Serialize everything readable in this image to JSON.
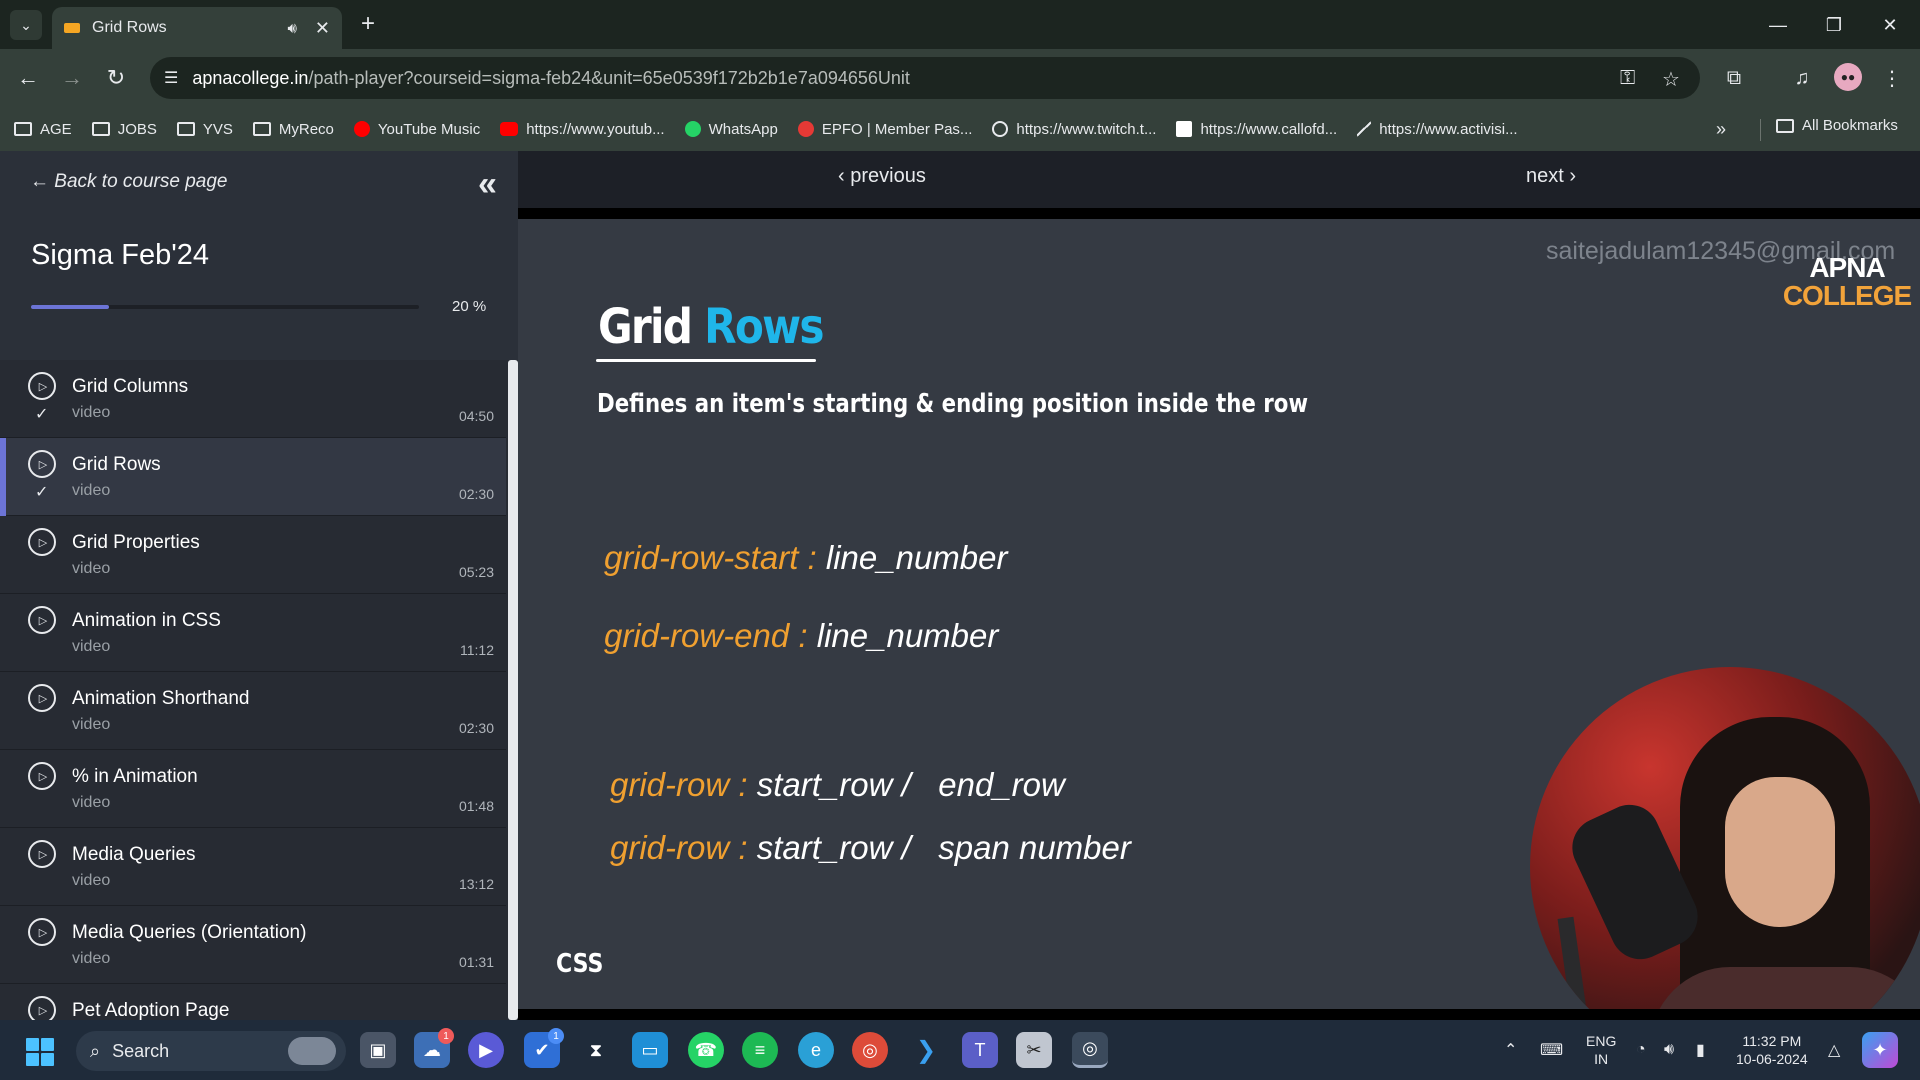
{
  "browser": {
    "tab": {
      "title": "Grid Rows"
    },
    "address": {
      "host": "apnacollege.in",
      "path": "/path-player?courseid=sigma-feb24&unit=65e0539f172b2b1e7a094656Unit"
    },
    "bookmarks": [
      {
        "label": "AGE",
        "icon": "folder-icon"
      },
      {
        "label": "JOBS",
        "icon": "folder-icon"
      },
      {
        "label": "YVS",
        "icon": "folder-icon"
      },
      {
        "label": "MyReco",
        "icon": "folder-icon"
      },
      {
        "label": "YouTube Music",
        "icon": "youtube-music-icon"
      },
      {
        "label": "https://www.youtub...",
        "icon": "youtube-icon"
      },
      {
        "label": "WhatsApp",
        "icon": "whatsapp-icon"
      },
      {
        "label": "EPFO | Member Pas...",
        "icon": "epfo-icon"
      },
      {
        "label": "https://www.twitch.t...",
        "icon": "globe-icon"
      },
      {
        "label": "https://www.callofd...",
        "icon": "callofduty-icon"
      },
      {
        "label": "https://www.activisi...",
        "icon": "activision-icon"
      }
    ],
    "all_bookmarks": "All Bookmarks"
  },
  "sidebar": {
    "back_label": "Back to course page",
    "course_title": "Sigma Feb'24",
    "progress": {
      "percent": 20,
      "label": "20 %"
    },
    "lessons": [
      {
        "title": "Grid Columns",
        "type": "video",
        "duration": "04:50",
        "completed": true,
        "active": false
      },
      {
        "title": "Grid Rows",
        "type": "video",
        "duration": "02:30",
        "completed": true,
        "active": true
      },
      {
        "title": "Grid Properties",
        "type": "video",
        "duration": "05:23",
        "completed": false,
        "active": false
      },
      {
        "title": "Animation in CSS",
        "type": "video",
        "duration": "11:12",
        "completed": false,
        "active": false
      },
      {
        "title": "Animation Shorthand",
        "type": "video",
        "duration": "02:30",
        "completed": false,
        "active": false
      },
      {
        "title": "% in Animation",
        "type": "video",
        "duration": "01:48",
        "completed": false,
        "active": false
      },
      {
        "title": "Media Queries",
        "type": "video",
        "duration": "13:12",
        "completed": false,
        "active": false
      },
      {
        "title": "Media Queries (Orientation)",
        "type": "video",
        "duration": "01:31",
        "completed": false,
        "active": false
      },
      {
        "title": "Pet Adoption Page",
        "type": "video",
        "duration": "",
        "completed": false,
        "active": false
      }
    ]
  },
  "content": {
    "previous_label": "previous",
    "next_label": "next"
  },
  "slide": {
    "watermark": "saitejadulam12345@gmail.com",
    "logo_line1": "APNA",
    "logo_line2": "COLLEGE",
    "title_part1": "Grid",
    "title_part2": "Rows",
    "subtitle": "Defines an item's starting & ending position inside the row",
    "code": [
      {
        "prop": "grid-row-start :",
        "value": "line_number"
      },
      {
        "prop": "grid-row-end :",
        "value": "line_number"
      },
      {
        "prop": "grid-row :",
        "value": "start_row /   end_row"
      },
      {
        "prop": "grid-row :",
        "value": "start_row /   span number"
      }
    ],
    "footer_label": "CSS",
    "playback_progress": 0.015
  },
  "taskbar": {
    "search_label": "Search",
    "lang_line1": "ENG",
    "lang_line2": "IN",
    "time": "11:32 PM",
    "date": "10-06-2024",
    "badge_weather": "1",
    "badge_todo": "1"
  },
  "colors": {
    "accent": "#6c74d6",
    "code_property": "#f0a030",
    "title_highlight": "#1fb6ea",
    "logo_orange": "#f2a33a"
  }
}
